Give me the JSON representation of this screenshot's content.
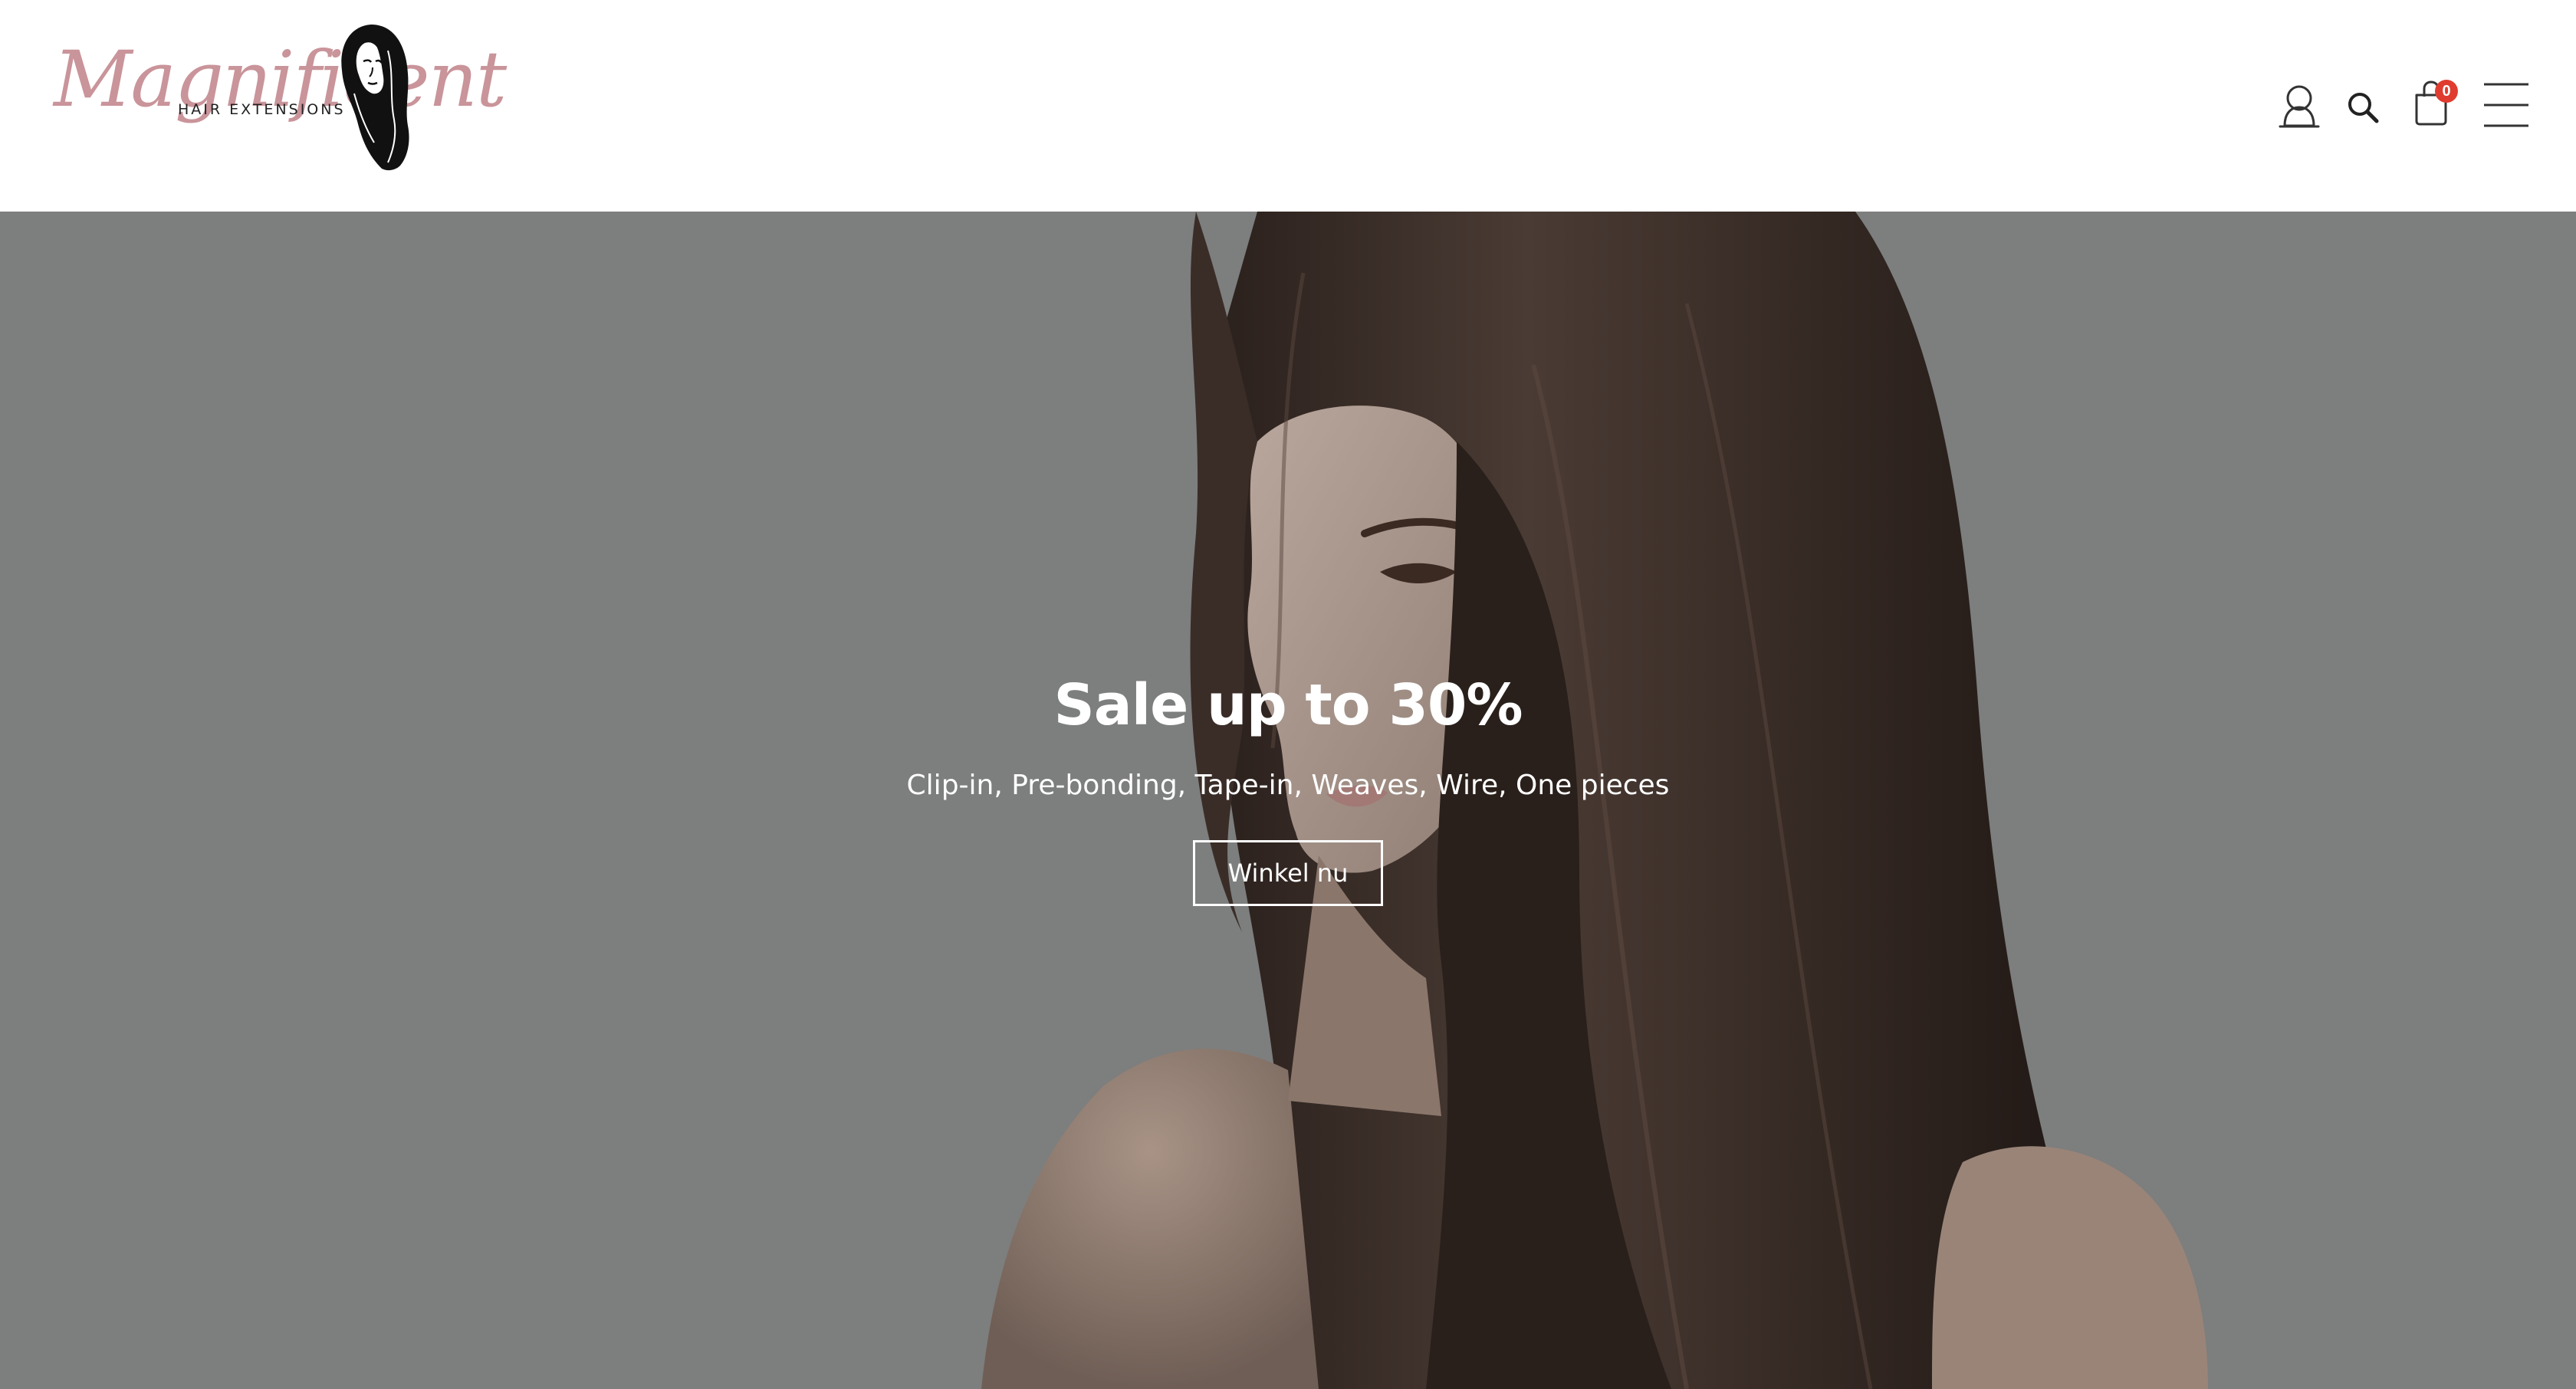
{
  "header": {
    "logo": {
      "script_text": "Magnificent",
      "sub_text": "HAIR EXTENSIONS",
      "script_color": "#c9949a"
    },
    "icons": [
      {
        "name": "account-icon"
      },
      {
        "name": "search-icon"
      },
      {
        "name": "cart-icon",
        "badge": "0",
        "badge_color": "#e03b2f"
      },
      {
        "name": "hamburger-menu-icon"
      }
    ]
  },
  "hero": {
    "title": "Sale up to 30%",
    "subtitle": "Clip-in, Pre-bonding, Tape-in, Weaves, Wire, One pieces",
    "button_label": "Winkel nu",
    "background_color": "#7d7e7e"
  }
}
